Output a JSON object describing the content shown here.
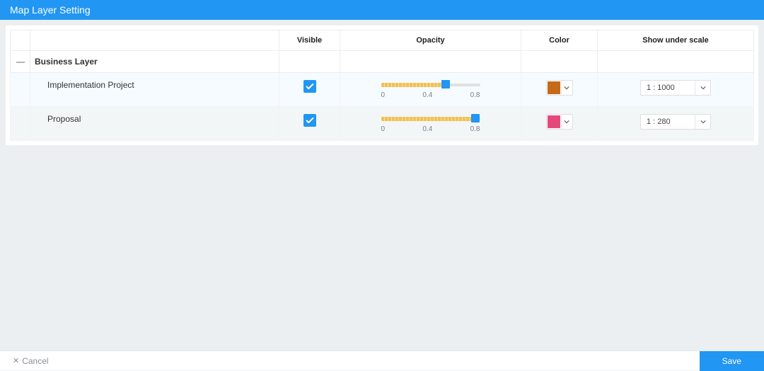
{
  "title": "Map Layer Setting",
  "columns": {
    "visible": "Visible",
    "opacity": "Opacity",
    "color": "Color",
    "scale": "Show under scale"
  },
  "group": {
    "name": "Business Layer"
  },
  "slider_ticks": [
    "0",
    "0.4",
    "0.8"
  ],
  "rows": [
    {
      "name": "Implementation Project",
      "visible": true,
      "opacity": 0.65,
      "color": "#c56a17",
      "scale": "1 : 1000"
    },
    {
      "name": "Proposal",
      "visible": true,
      "opacity": 0.95,
      "color": "#e6487c",
      "scale": "1 : 280"
    }
  ],
  "footer": {
    "cancel": "Cancel",
    "save": "Save"
  }
}
